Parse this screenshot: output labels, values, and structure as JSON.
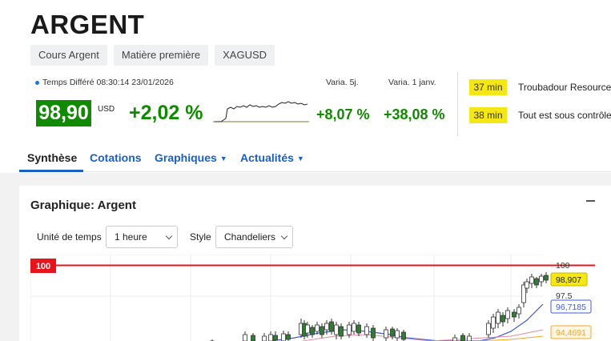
{
  "header": {
    "title": "ARGENT",
    "tags": [
      "Cours Argent",
      "Matière première",
      "XAGUSD"
    ]
  },
  "quote": {
    "delay_text": "Temps Différé 08:30:14 23/01/2026",
    "price": "98,90",
    "currency": "USD",
    "change": "+2,02 %",
    "var_5d_label": "Varia. 5j.",
    "var_5d": "+8,07 %",
    "var_ytd_label": "Varia. 1 janv.",
    "var_ytd": "+38,08 %",
    "up_color": "#108a00"
  },
  "news": [
    {
      "time": "37 min",
      "text": "Troubadour Resource"
    },
    {
      "time": "38 min",
      "text": "Tout est sous contrôle"
    }
  ],
  "tabs": [
    {
      "label": "Synthèse",
      "active": true
    },
    {
      "label": "Cotations"
    },
    {
      "label": "Graphiques",
      "dropdown": true
    },
    {
      "label": "Actualités",
      "dropdown": true
    }
  ],
  "chart_panel": {
    "title": "Graphique: Argent",
    "interval_label": "Unité de temps",
    "interval_value": "1 heure",
    "style_label": "Style",
    "style_value": "Chandeliers"
  },
  "chart_data": {
    "type": "candlestick",
    "level_line": {
      "value": 100,
      "label": "100",
      "color": "#e8141c"
    },
    "axis_labels": [
      "100",
      "97.5"
    ],
    "price_markers": [
      {
        "label": "98,907",
        "color": "#f5e615"
      },
      {
        "label": "96,7185",
        "color": "#3f5bd6"
      },
      {
        "label": "94,4691",
        "color": "#f5a623"
      }
    ]
  }
}
